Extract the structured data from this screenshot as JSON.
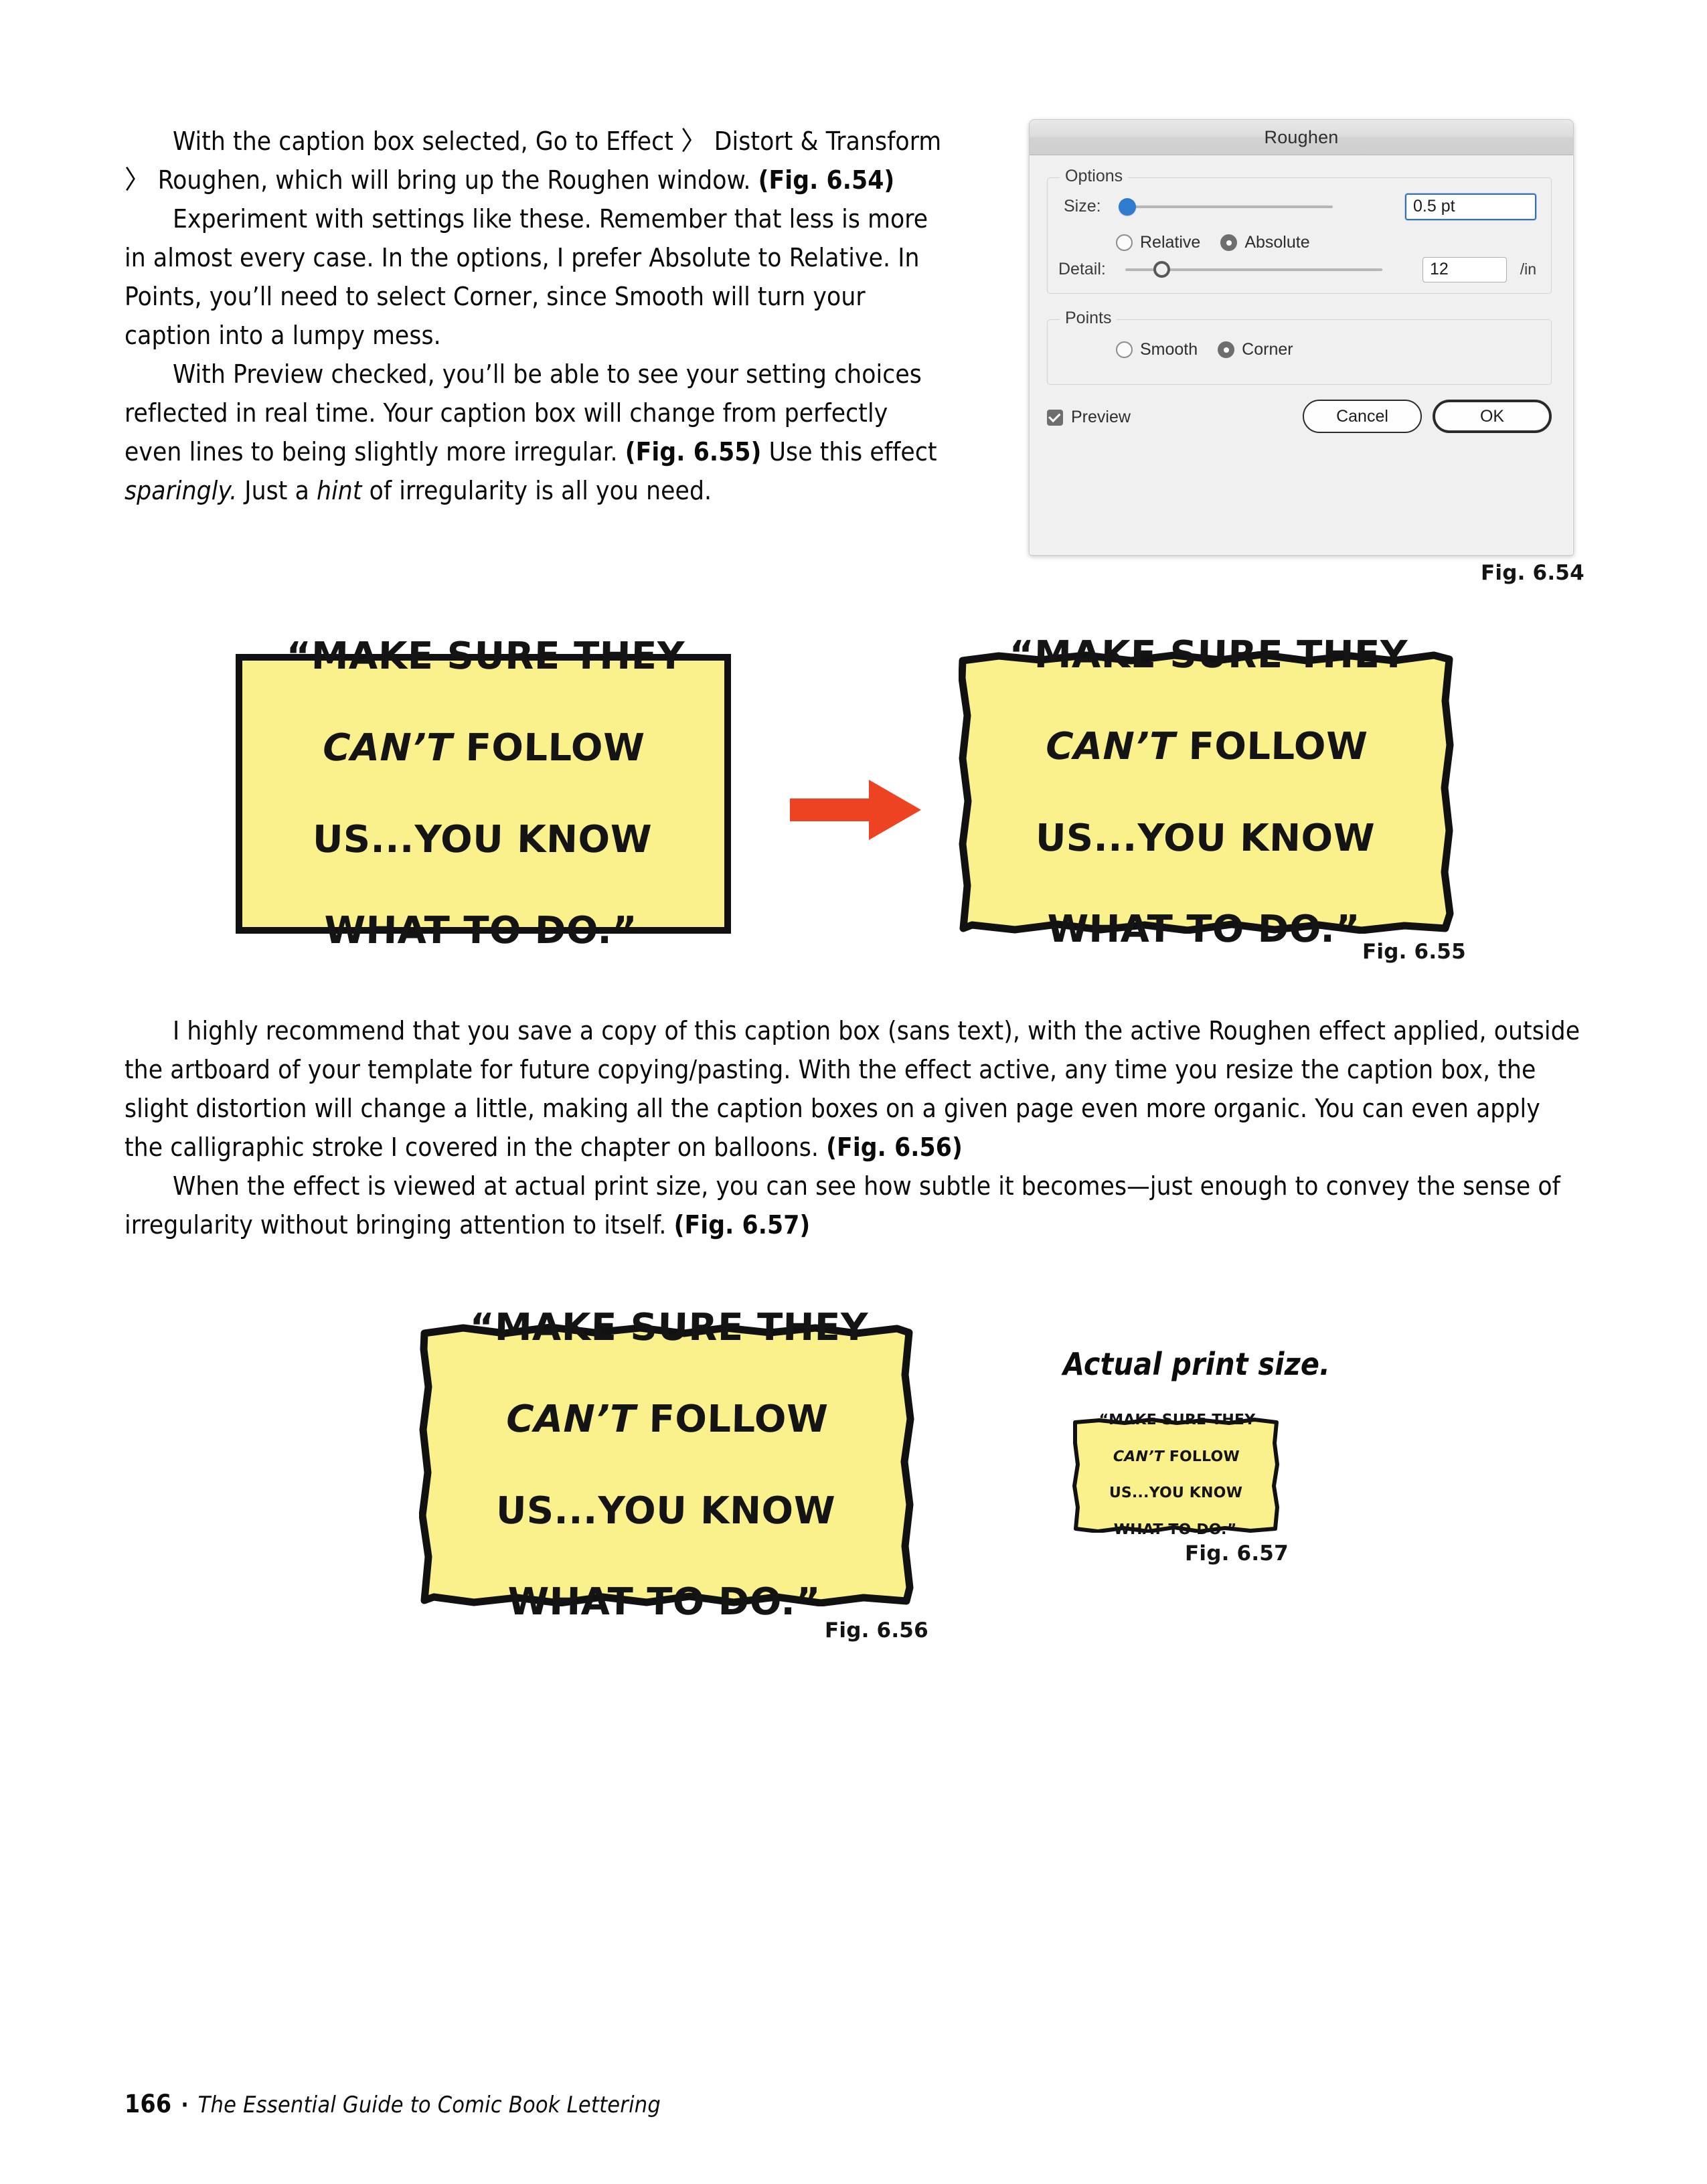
{
  "page": {
    "number": "166",
    "separator": "·",
    "book_title": "The Essential Guide to Comic Book Lettering"
  },
  "body": {
    "para1_a": "With the caption box selected, Go to Effect 〉 Distort & Transform 〉 Roughen, which will bring up the Roughen window. ",
    "para1_fig": "(Fig. 6.54)",
    "para2": "Experiment with settings like these. Remember that less is more in almost every case. In the options, I prefer Absolute to Relative. In Points, you’ll need to select Corner, since Smooth will turn your caption into a lumpy mess.",
    "para3_a": "With Preview checked, you’ll be able to see your setting choices reflected in real time. Your caption box will change from perfectly even lines to being slightly more irregular. ",
    "para3_fig": "(Fig. 6.55)",
    "para3_b": " Use this effect ",
    "para3_i1": "sparingly.",
    "para3_c": " Just a ",
    "para3_i2": "hint",
    "para3_d": " of irregularity is all you need.",
    "para4_a": "I highly recommend that you save a copy of this caption box (sans text), with the active Roughen effect applied, outside the artboard of your template for future copying/pasting. With the effect active, any time you resize the caption box, the slight distortion will change a little, making all the caption boxes on a given page even more organic. You can even apply the calligraphic stroke I covered in the chapter on balloons. ",
    "para4_fig": "(Fig. 6.56)",
    "para5_a": "When the effect is viewed at actual print size, you can see how subtle it becomes—just enough to convey the sense of irregularity without bringing attention to itself. ",
    "para5_fig": "(Fig. 6.57)"
  },
  "dialog": {
    "title": "Roughen",
    "options_group_label": "Options",
    "size_label": "Size:",
    "size_value": "0.5 pt",
    "size_slider_percent": 0,
    "relative_label": "Relative",
    "absolute_label": "Absolute",
    "size_mode_selected": "Absolute",
    "detail_label": "Detail:",
    "detail_value": "12",
    "detail_unit": "/in",
    "detail_slider_percent": 12,
    "points_group_label": "Points",
    "smooth_label": "Smooth",
    "corner_label": "Corner",
    "points_selected": "Corner",
    "preview_label": "Preview",
    "preview_checked": true,
    "cancel_label": "Cancel",
    "ok_label": "OK",
    "accent_blue": "#2f7bd0",
    "dialog_bg": "#f0f0f0",
    "titlebar_bg": "#d8d8d8"
  },
  "captions": {
    "text": "“MAKE SURE THEY\nCAN’T FOLLOW\nUS...YOU KNOW\nWHAT TO DO.”",
    "line1": "“MAKE SURE THEY",
    "line2_em": "CAN’T",
    "line2_rest": " FOLLOW",
    "line3": "US...YOU KNOW",
    "line4": "WHAT TO DO.”",
    "box_fill": "#faf08c",
    "box_stroke": "#111111"
  },
  "figures": {
    "fig_654": "Fig. 6.54",
    "fig_655": "Fig. 6.55",
    "fig_656": "Fig. 6.56",
    "fig_657": "Fig. 6.57",
    "actual_print_size": "Actual print size.",
    "arrow_color": "#ee4323"
  }
}
